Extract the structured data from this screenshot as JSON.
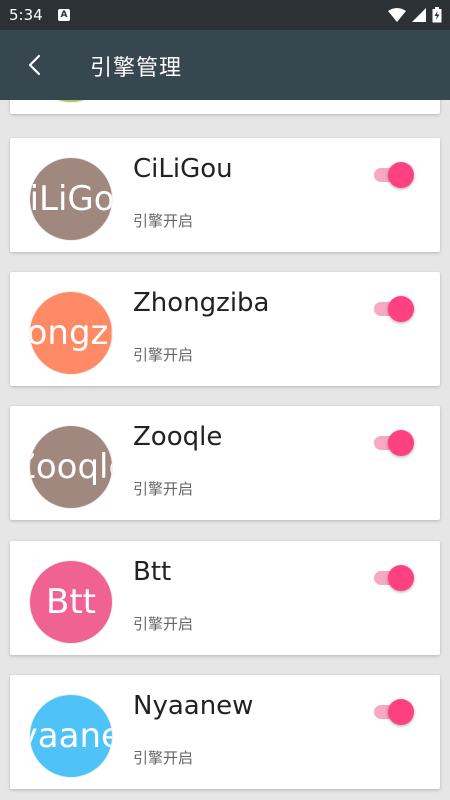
{
  "status_bar": {
    "time": "5:34",
    "notif_label": "A"
  },
  "app_bar": {
    "title": "引擎管理"
  },
  "engines": [
    {
      "avatar_text": "CiLiGou",
      "name": "CiLiGou",
      "status": "引擎开启",
      "enabled": true,
      "avatar_color": "#a1887f"
    },
    {
      "avatar_text": "Zhongziba",
      "name": "Zhongziba",
      "status": "引擎开启",
      "enabled": true,
      "avatar_color": "#ff8a65"
    },
    {
      "avatar_text": "Zooqle",
      "name": "Zooqle",
      "status": "引擎开启",
      "enabled": true,
      "avatar_color": "#a1887f"
    },
    {
      "avatar_text": "Btt",
      "name": "Btt",
      "status": "引擎开启",
      "enabled": true,
      "avatar_color": "#f06292"
    },
    {
      "avatar_text": "Nyaanew",
      "name": "Nyaanew",
      "status": "引擎开启",
      "enabled": true,
      "avatar_color": "#4fc3f7"
    }
  ],
  "partial_card": {
    "avatar_color": "#9ccc65"
  },
  "colors": {
    "app_bar": "#37474f",
    "status_bar": "#2b3134",
    "toggle_on": "#ff4081",
    "toggle_track": "#f6a9c2"
  }
}
